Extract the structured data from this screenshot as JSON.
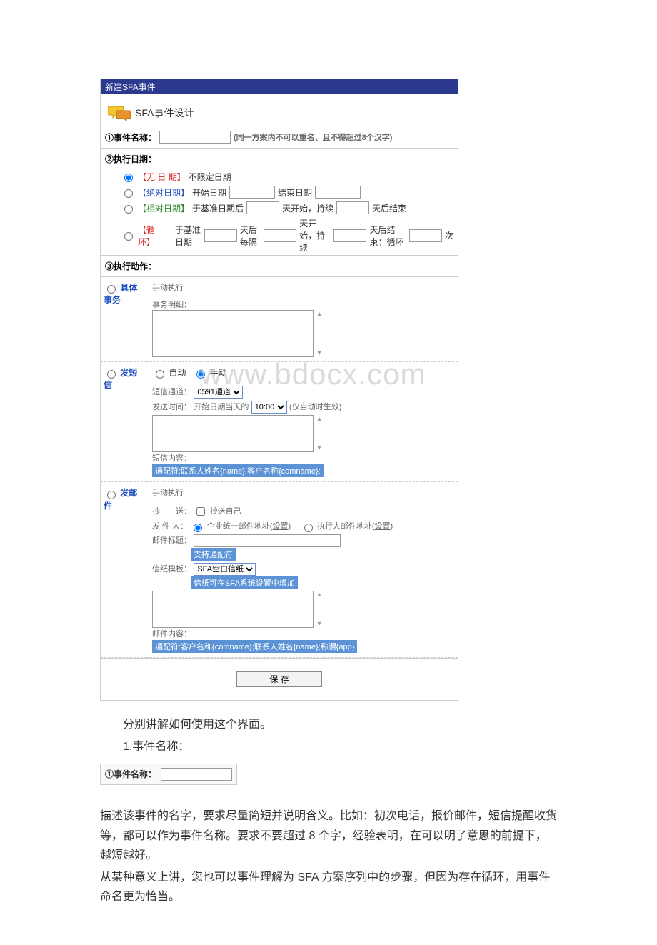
{
  "header": {
    "title": "新建SFA事件"
  },
  "design": {
    "title": "SFA事件设计"
  },
  "eventName": {
    "label": "①事件名称：",
    "hint": "(同一方案内不可以重名、且不得超过8个汉字)"
  },
  "execDate": {
    "heading": "②执行日期：",
    "opts": {
      "none": {
        "tag": "【无 日 期】",
        "text": "不限定日期"
      },
      "abs": {
        "tag": "【绝对日期】",
        "start": "开始日期",
        "end": "结束日期"
      },
      "rel": {
        "tag": "【相对日期】",
        "t1": "于基准日期后",
        "t2": "天开始，持续",
        "t3": "天后结束"
      },
      "loop": {
        "tag": "【循　　环】",
        "t1": "于基准日期",
        "t2": "天后每隔",
        "t3": "天开始，持续",
        "t4": "天后结束；循环",
        "t5": "次"
      }
    }
  },
  "execAction": {
    "heading": "③执行动作："
  },
  "task": {
    "name": "具体事务",
    "manual": "手动执行",
    "detailLabel": "事务明细："
  },
  "sms": {
    "name": "发短信",
    "autoLabel": "自动",
    "manualLabel": "手动",
    "channelLabel": "短信通道：",
    "channelValue": "0591通道",
    "sendTimeLabel": "发送时间：",
    "sendTimeText1": "开始日期当天的",
    "sendTimeValue": "10:00",
    "sendTimeText2": "(仅自动时生效)",
    "contentLabel": "短信内容：",
    "wildcard": "通配符:联系人姓名{name};客户名称{comname};"
  },
  "mail": {
    "name": "发邮件",
    "manual": "手动执行",
    "ccLabel": "抄　　送：",
    "ccSelf": "抄送自己",
    "senderLabel": "发 件 人：",
    "senderOpt1": "企业统一邮件地址(",
    "senderOpt1Link": "设置",
    "senderOpt1Close": ")",
    "senderOpt2": "执行人邮件地址(",
    "senderOpt2Link": "设置",
    "senderOpt2Close": ")",
    "subjectLabel": "邮件标题：",
    "supportWildcard": "支持通配符",
    "tplLabel": "信纸模板：",
    "tplValue": "SFA空白信纸",
    "tplHint": "信纸可在SFA系统设置中增加",
    "contentLabel": "邮件内容：",
    "wildcard": "通配符:客户名称{comname};联系人姓名{name};称谓{app}"
  },
  "saveBtn": "保 存",
  "doc": {
    "p1": "分别讲解如何使用这个界面。",
    "h1": "1.事件名称：",
    "miniLabel": "①事件名称：",
    "p2": "描述该事件的名字，要求尽量简短并说明含义。比如：初次电话，报价邮件，短信提醒收货等，都可以作为事件名称。要求不要超过 8 个字，经验表明，在可以明了意思的前提下，越短越好。",
    "p3": "从某种意义上讲，您也可以事件理解为 SFA 方案序列中的步骤，但因为存在循环，用事件命名更为恰当。"
  },
  "watermark": "www.bdocx.com"
}
